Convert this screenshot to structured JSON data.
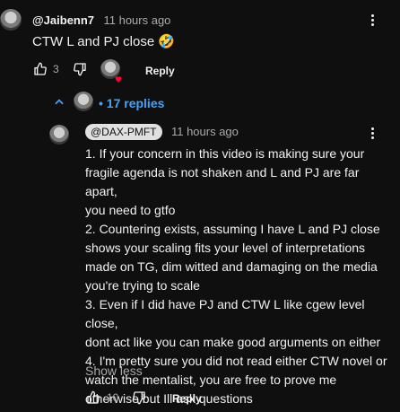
{
  "comment1": {
    "author": "@Jaibenn7",
    "time": "11 hours ago",
    "text": "CTW L and PJ close 🤣",
    "like_count": "3",
    "reply_label": "Reply"
  },
  "replies_toggle": {
    "label": "17 replies",
    "bullet": "•"
  },
  "reply1": {
    "author": "@DAX-PMFT",
    "time": "11 hours ago",
    "text_lines": [
      "1. If your concern in this video is making sure your",
      "fragile agenda is not shaken and L and PJ are far apart,",
      "you need to gtfo",
      "2. Countering exists, assuming I have L and PJ close",
      "shows your scaling fits your level of interpretations",
      "made on TG, dim witted and damaging on the media",
      "you're trying to scale",
      "3. Even if I did have PJ and CTW L like cgew level close,",
      "dont act like you can make good arguments on either",
      "4. I'm pretty sure you did not read either CTW novel or",
      "watch the mentalist, you are free to prove me",
      "otherwise but Ill ask questions"
    ],
    "show_less": "Show less",
    "like_count": "10",
    "reply_label": "Reply"
  },
  "icons": {
    "like": "thumbs-up-icon",
    "dislike": "thumbs-down-icon",
    "more": "more-vertical-icon",
    "collapse": "chevron-up-icon",
    "creator_heart": "heart-icon"
  },
  "colors": {
    "background": "#0f0f0f",
    "text": "#f1f1f1",
    "muted": "#aaaaaa",
    "link": "#3ea6ff",
    "heart": "#ff0033"
  }
}
